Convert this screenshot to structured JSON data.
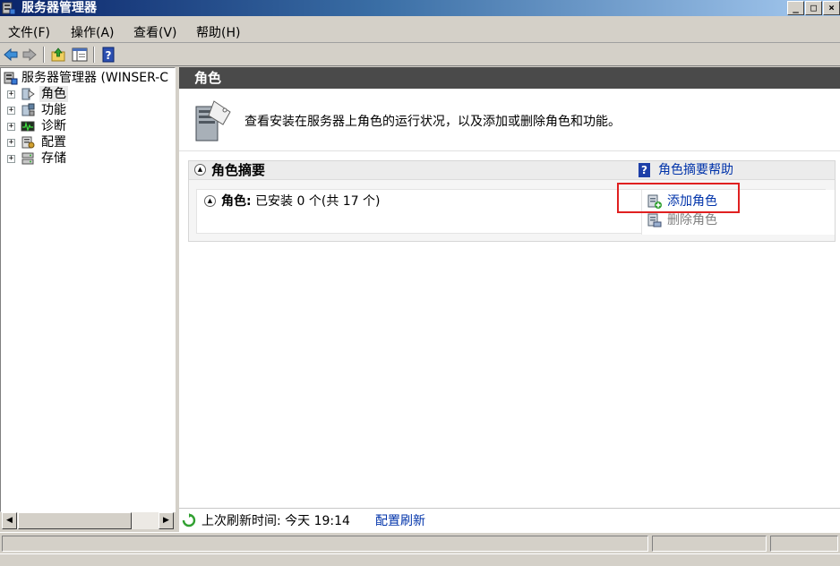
{
  "window": {
    "title": "服务器管理器",
    "min_glyph": "_",
    "max_glyph": "□",
    "close_glyph": "×"
  },
  "menu": {
    "items": [
      {
        "label": "文件(F)"
      },
      {
        "label": "操作(A)"
      },
      {
        "label": "查看(V)"
      },
      {
        "label": "帮助(H)"
      }
    ]
  },
  "tree": {
    "root": {
      "label": "服务器管理器 (WINSER-C"
    },
    "items": [
      {
        "label": "角色",
        "expander": "+"
      },
      {
        "label": "功能",
        "expander": "+"
      },
      {
        "label": "诊断",
        "expander": "+"
      },
      {
        "label": "配置",
        "expander": "+"
      },
      {
        "label": "存储",
        "expander": "+"
      }
    ]
  },
  "scrollbar": {
    "left_glyph": "◀",
    "right_glyph": "▶"
  },
  "right_pane": {
    "header": "角色",
    "intro": "查看安装在服务器上角色的运行状况，以及添加或删除角色和功能。",
    "summary": {
      "title": "角色摘要",
      "help_link": "角色摘要帮助",
      "help_icon_glyph": "?",
      "roles_label": "角色:",
      "roles_status": "已安装 0 个(共 17 个)",
      "collapse_glyph": "▲",
      "actions": [
        {
          "label": "添加角色",
          "enabled": true
        },
        {
          "label": "删除角色",
          "enabled": false
        }
      ]
    },
    "refresh": {
      "text": "上次刷新时间: 今天 19:14",
      "link": "配置刷新"
    }
  },
  "colors": {
    "link": "#0033aa",
    "highlight": "#e02020",
    "header_bg": "#4a4a4a",
    "title_gradient_start": "#0a246a"
  },
  "icons": {
    "back": "back-arrow-icon",
    "forward": "forward-arrow-icon",
    "up": "up-folder-icon",
    "show_hide": "show-hide-tree-icon",
    "help": "help-icon"
  }
}
